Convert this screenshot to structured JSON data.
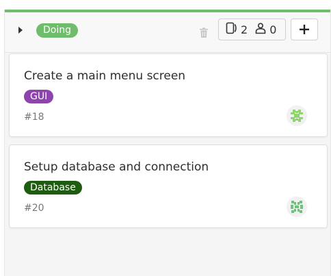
{
  "colors": {
    "accent": "#6ebd6b"
  },
  "list": {
    "title": "Doing",
    "issue_count": "2",
    "assignee_count": "0",
    "collapse_icon": "caret-right-icon",
    "delete_icon": "trash-icon",
    "issues_icon": "issues-icon",
    "assignees_icon": "person-icon",
    "add_icon": "plus-icon"
  },
  "cards": [
    {
      "title": "Create a main menu screen",
      "label": "GUI",
      "label_color": "#8e44ad",
      "number": "#18",
      "avatar_icon": "identicon-avatar"
    },
    {
      "title": "Setup database and connection",
      "label": "Database",
      "label_color": "#1e5c0f",
      "number": "#20",
      "avatar_icon": "identicon-avatar"
    }
  ]
}
